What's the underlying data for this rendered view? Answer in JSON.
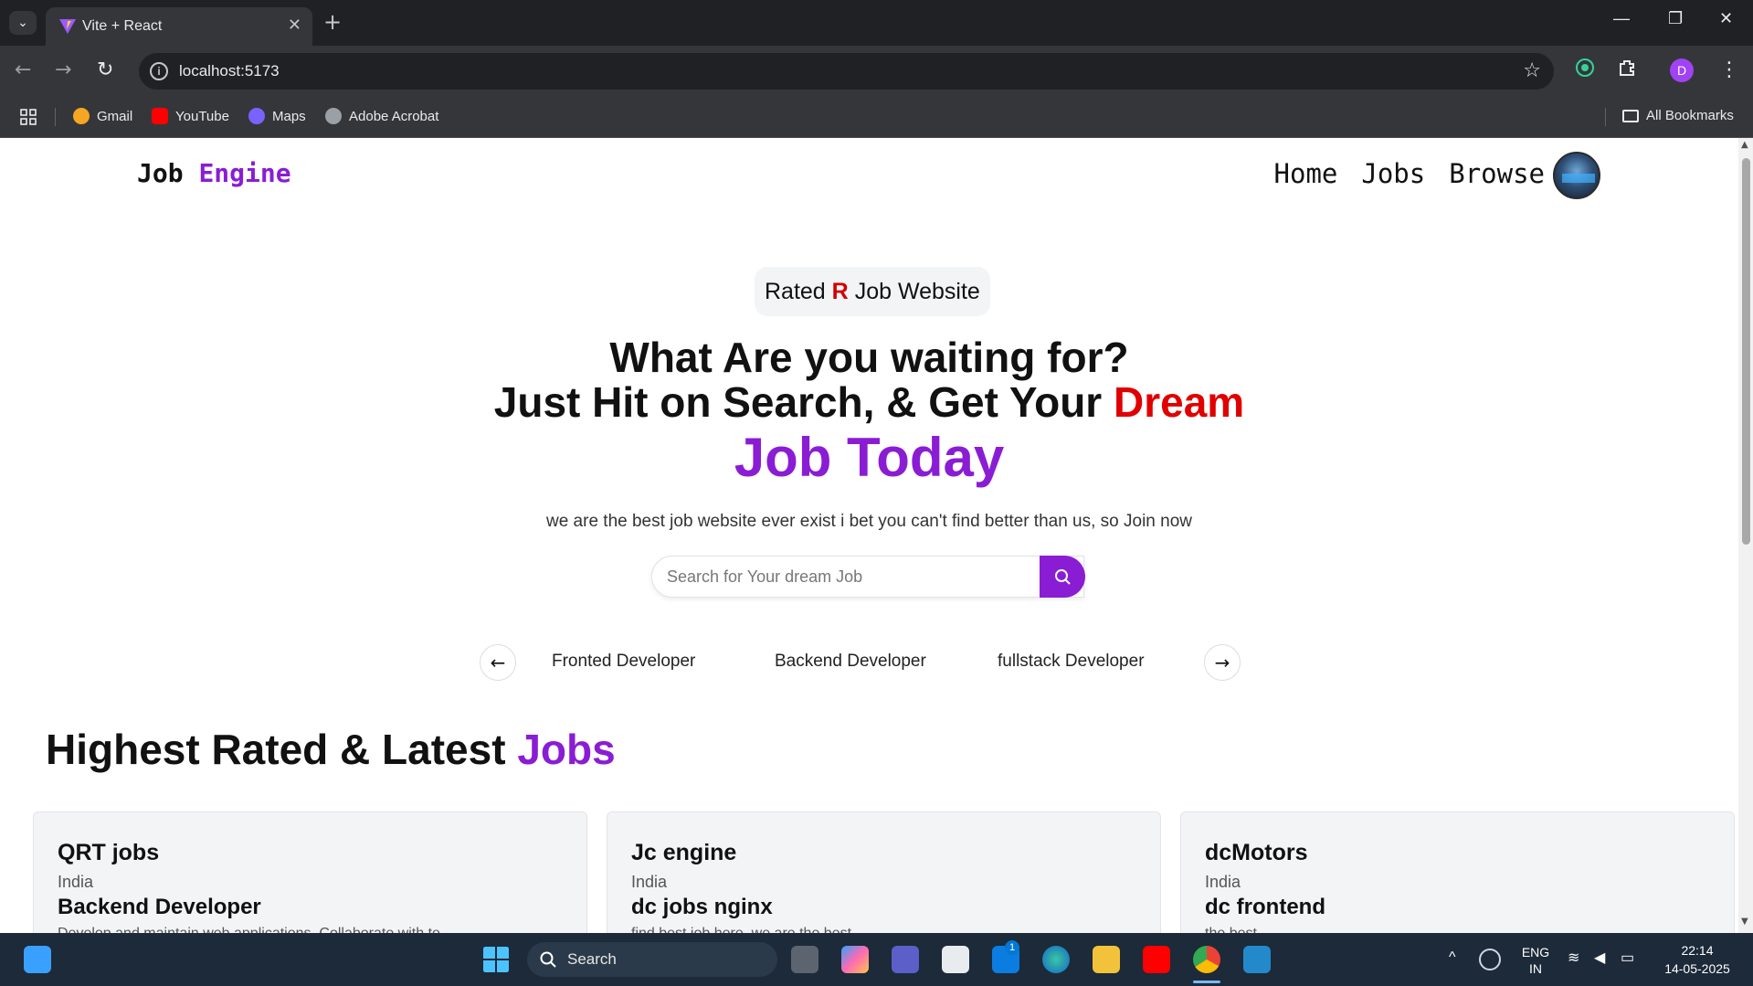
{
  "browser": {
    "tab_title": "Vite + React",
    "url": "localhost:5173",
    "bookmarks": [
      {
        "label": "Gmail",
        "color": "#f5a623"
      },
      {
        "label": "YouTube",
        "color": "#ff0000"
      },
      {
        "label": "Maps",
        "color": "#7b61ff"
      },
      {
        "label": "Adobe Acrobat",
        "color": "#9aa0a6"
      }
    ],
    "all_bookmarks": "All Bookmarks",
    "profile_initial": "D"
  },
  "app": {
    "logo_part1": "Job",
    "logo_part2": "Engine",
    "nav": [
      "Home",
      "Jobs",
      "Browse"
    ],
    "accent_color": "#8a1dd4"
  },
  "hero": {
    "badge_before": "Rated",
    "badge_r": "R",
    "badge_after": "Job Website",
    "line1": "What Are you waiting for?",
    "line2_before": "Just Hit on Search, & Get Your",
    "line2_red": "Dream",
    "line3": "Job Today",
    "subtitle": "we are the best job website ever exist i bet you can't find better than us, so Join now",
    "search_placeholder": "Search for Your dream Job"
  },
  "categories": [
    "Fronted Developer",
    "Backend Developer",
    "fullstack Developer"
  ],
  "section": {
    "title_before": "Highest Rated & Latest",
    "title_purple": "Jobs"
  },
  "jobs": [
    {
      "company": "QRT jobs",
      "location": "India",
      "title": "Backend Developer",
      "description": "Develop and maintain web applications. Collaborate with te"
    },
    {
      "company": "Jc engine",
      "location": "India",
      "title": "dc jobs nginx",
      "description": "find best job here, we are the best"
    },
    {
      "company": "dcMotors",
      "location": "India",
      "title": "dc frontend",
      "description": "the best"
    }
  ],
  "taskbar": {
    "search_label": "Search",
    "lang_top": "ENG",
    "lang_bottom": "IN",
    "time": "22:14",
    "date": "14-05-2025",
    "notification_count": "1"
  }
}
